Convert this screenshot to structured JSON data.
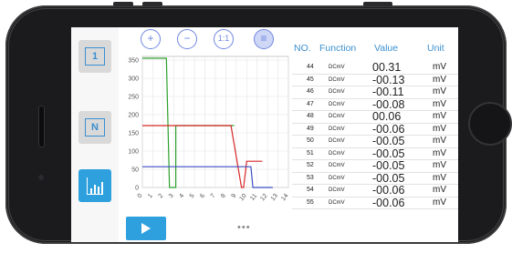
{
  "toolbar": {
    "zoom_in": "+",
    "zoom_out": "−",
    "reset": "1:1",
    "menu": "≡"
  },
  "sidebar": {
    "items": [
      {
        "label": "1",
        "icon": "single-window-icon",
        "active": false
      },
      {
        "label": "N",
        "icon": "multi-window-icon",
        "active": false
      },
      {
        "label": "",
        "icon": "bar-chart-icon",
        "active": true
      }
    ]
  },
  "table": {
    "headers": {
      "no": "NO.",
      "function": "Function",
      "value": "Value",
      "unit": "Unit"
    },
    "rows": [
      {
        "no": "44",
        "function": "DCmV",
        "value": "00.31",
        "unit": "mV"
      },
      {
        "no": "45",
        "function": "DCmV",
        "value": "-00.13",
        "unit": "mV"
      },
      {
        "no": "46",
        "function": "DCmV",
        "value": "-00.11",
        "unit": "mV"
      },
      {
        "no": "47",
        "function": "DCmV",
        "value": "-00.08",
        "unit": "mV"
      },
      {
        "no": "48",
        "function": "DCmV",
        "value": "00.06",
        "unit": "mV"
      },
      {
        "no": "49",
        "function": "DCmV",
        "value": "-00.06",
        "unit": "mV"
      },
      {
        "no": "50",
        "function": "DCmV",
        "value": "-00.05",
        "unit": "mV"
      },
      {
        "no": "51",
        "function": "DCmV",
        "value": "-00.05",
        "unit": "mV"
      },
      {
        "no": "52",
        "function": "DCmV",
        "value": "-00.05",
        "unit": "mV"
      },
      {
        "no": "53",
        "function": "DCmV",
        "value": "-00.05",
        "unit": "mV"
      },
      {
        "no": "54",
        "function": "DCmV",
        "value": "-00.06",
        "unit": "mV"
      },
      {
        "no": "55",
        "function": "DCmV",
        "value": "-00.06",
        "unit": "mV"
      }
    ]
  },
  "playback": {
    "dots": "•••"
  },
  "colors": {
    "accent": "#2ea0dd",
    "header_text": "#3a8fd0",
    "toolbar_icon": "#6f86e2",
    "series_green": "#2ca02c",
    "series_red": "#d62728",
    "series_blue": "#3b4cc0"
  },
  "chart_data": {
    "type": "line",
    "ylim": [
      0,
      360
    ],
    "yticks": [
      "0",
      "50",
      "100",
      "150",
      "200",
      "250",
      "300",
      "350"
    ],
    "xlim": [
      0,
      14
    ],
    "xticks": [
      "0",
      "1",
      "2",
      "3",
      "4",
      "5",
      "6",
      "7",
      "8",
      "9",
      "10",
      "11",
      "12",
      "13",
      "14"
    ],
    "grid": true,
    "series": [
      {
        "color": "#2ca02c",
        "x": [
          0,
          2.3,
          2.6,
          2.7,
          3.2,
          3.2,
          8.8
        ],
        "y": [
          355,
          355,
          0,
          0,
          0,
          170,
          170
        ]
      },
      {
        "color": "#d62728",
        "x": [
          0,
          8.5,
          8.5,
          9.5,
          9.7,
          10,
          11.5
        ],
        "y": [
          170,
          170,
          170,
          0,
          0,
          72,
          72
        ]
      },
      {
        "color": "#3b4cc0",
        "x": [
          0,
          9.6,
          9.8,
          10.4,
          10.6,
          12.5
        ],
        "y": [
          57,
          57,
          57,
          57,
          0,
          0
        ]
      }
    ]
  }
}
